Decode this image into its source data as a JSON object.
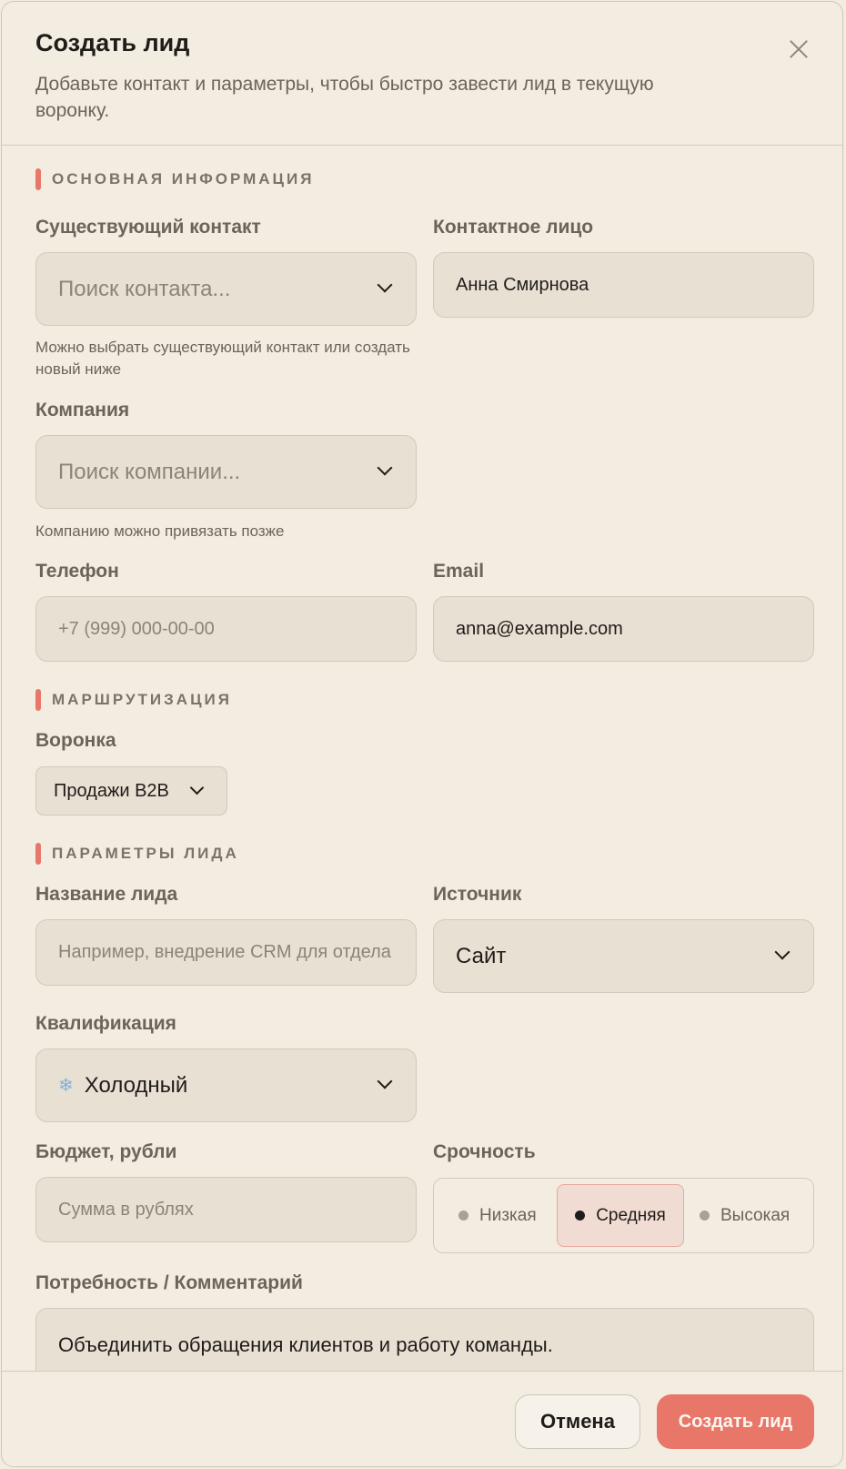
{
  "header": {
    "title": "Создать лид",
    "subtitle": "Добавьте контакт и параметры, чтобы быстро завести лид в текущую воронку."
  },
  "sections": {
    "basic": "ОСНОВНАЯ ИНФОРМАЦИЯ",
    "routing": "МАРШРУТИЗАЦИЯ",
    "params": "ПАРАМЕТРЫ ЛИДА"
  },
  "existing_contact": {
    "label": "Существующий контакт",
    "placeholder": "Поиск контакта...",
    "hint": "Можно выбрать существующий контакт или создать новый ниже"
  },
  "contact_person": {
    "label": "Контактное лицо",
    "value": "Анна Смирнова"
  },
  "company": {
    "label": "Компания",
    "placeholder": "Поиск компании...",
    "hint": "Компанию можно привязать позже"
  },
  "phone": {
    "label": "Телефон",
    "placeholder": "+7 (999) 000-00-00"
  },
  "email": {
    "label": "Email",
    "value": "anna@example.com"
  },
  "funnel": {
    "label": "Воронка",
    "value": "Продажи B2B"
  },
  "lead_name": {
    "label": "Название лида",
    "placeholder": "Например, внедрение CRM для отдела"
  },
  "source": {
    "label": "Источник",
    "value": "Сайт"
  },
  "qualification": {
    "label": "Квалификация",
    "icon": "snowflake-icon",
    "value": "Холодный"
  },
  "budget": {
    "label": "Бюджет, рубли",
    "placeholder": "Сумма в рублях"
  },
  "urgency": {
    "label": "Срочность",
    "options": [
      "Низкая",
      "Средняя",
      "Высокая"
    ],
    "selected": "Средняя"
  },
  "comment": {
    "label": "Потребность / Комментарий",
    "value": "Объединить обращения клиентов и работу команды."
  },
  "footer": {
    "cancel": "Отмена",
    "submit": "Создать лид"
  },
  "colors": {
    "accent": "#e8776a",
    "background": "#f3ece1",
    "field": "#e8e0d3"
  }
}
